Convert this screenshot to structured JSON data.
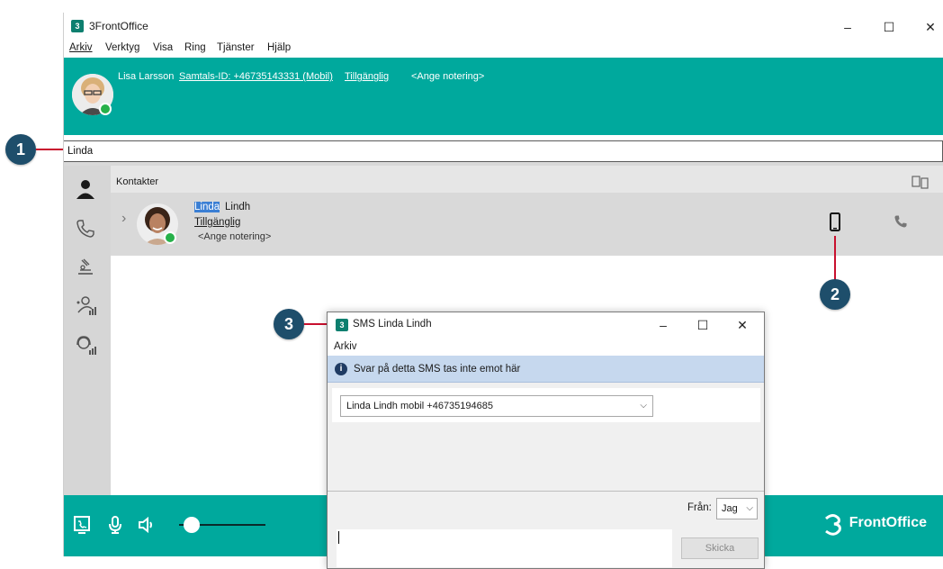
{
  "window": {
    "title": "3FrontOffice",
    "menu": [
      "Arkiv",
      "Verktyg",
      "Visa",
      "Ring",
      "Tjänster",
      "Hjälp"
    ],
    "controls": {
      "minimize": "–",
      "maximize": "☐",
      "close": "✕"
    }
  },
  "header": {
    "user_name": "Lisa Larsson",
    "call_id": "Samtals-ID: +46735143331 (Mobil)",
    "status": "Tillgänglig",
    "note": "<Ange notering>"
  },
  "search": {
    "value": "Linda"
  },
  "contacts": {
    "section_label": "Kontakter",
    "items": [
      {
        "first_name": "Linda",
        "last_name": "Lindh",
        "status": "Tillgänglig",
        "note": "<Ange notering>"
      }
    ]
  },
  "bottombar": {
    "logo_text": "FrontOffice",
    "volume": 0.15
  },
  "sms_dialog": {
    "title": "SMS Linda Lindh",
    "menu": [
      "Arkiv"
    ],
    "info": "Svar på detta SMS tas inte emot här",
    "recipient": "Linda Lindh mobil +46735194685",
    "from_label": "Från:",
    "from_value": "Jag",
    "send_label": "Skicka",
    "message": ""
  },
  "callouts": [
    "1",
    "2",
    "3"
  ],
  "colors": {
    "teal": "#00a99d",
    "callout": "#1e4e6b",
    "callout_line": "#c8102e",
    "status_green": "#27b14a"
  }
}
